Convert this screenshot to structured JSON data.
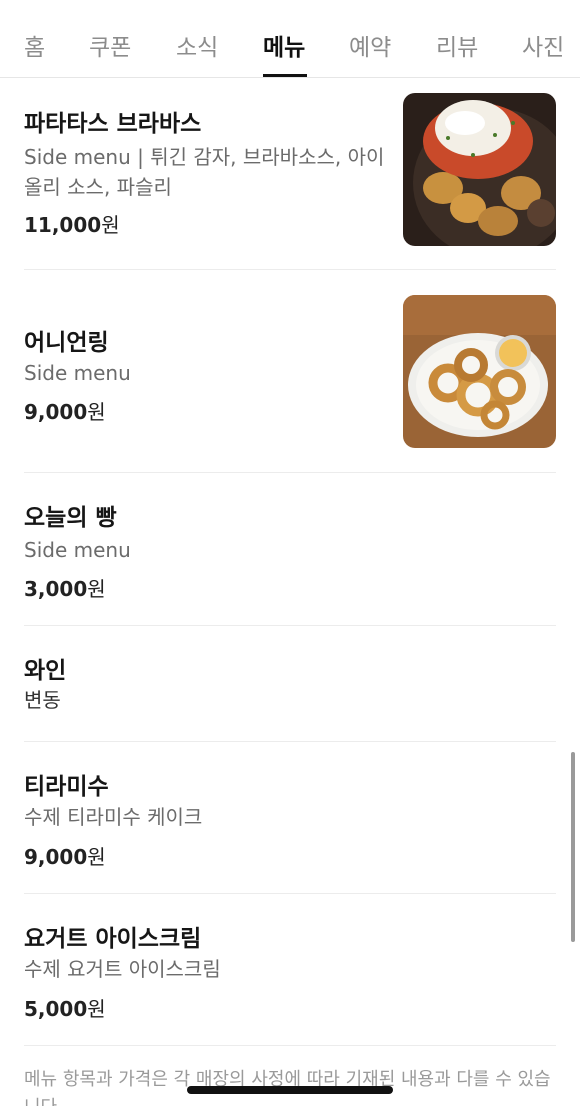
{
  "tabs": [
    {
      "label": "홈"
    },
    {
      "label": "쿠폰"
    },
    {
      "label": "소식"
    },
    {
      "label": "메뉴",
      "active": true
    },
    {
      "label": "예약"
    },
    {
      "label": "리뷰"
    },
    {
      "label": "사진"
    }
  ],
  "menu": [
    {
      "name": "파타타스 브라바스",
      "desc_line1": "Side menu | 튀긴 감자, 브라바소스, 아이",
      "desc_line2": "올리 소스, 파슬리",
      "price": "11,000",
      "unit": "원",
      "image": "patatas-bravas-photo"
    },
    {
      "name": "어니언링",
      "desc": "Side menu",
      "price": "9,000",
      "unit": "원",
      "image": "onion-rings-photo"
    },
    {
      "name": "오늘의 빵",
      "desc": "Side menu",
      "price": "3,000",
      "unit": "원"
    },
    {
      "name": "와인",
      "desc": "변동"
    },
    {
      "name": "티라미수",
      "desc": "수제 티라미수 케이크",
      "price": "9,000",
      "unit": "원"
    },
    {
      "name": "요거트 아이스크림",
      "desc": "수제 요거트 아이스크림",
      "price": "5,000",
      "unit": "원"
    }
  ],
  "notice": "메뉴 항목과 가격은 각 매장의 사정에 따라 기재된 내용과 다를 수 있습니다."
}
